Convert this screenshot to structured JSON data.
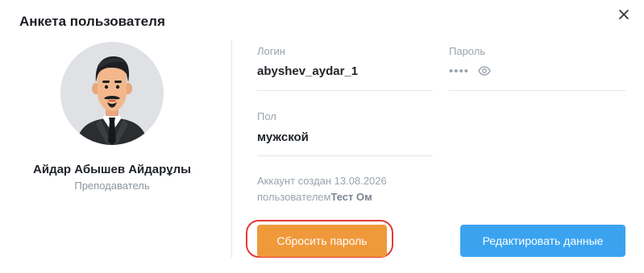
{
  "modal": {
    "title": "Анкета пользователя"
  },
  "user": {
    "name": "Айдар Абышев Айдарұлы",
    "role": "Преподаватель"
  },
  "fields": {
    "login_label": "Логин",
    "login_value": "abyshev_aydar_1",
    "password_label": "Пароль",
    "password_mask": "••••",
    "gender_label": "Пол",
    "gender_value": "мужской"
  },
  "created": {
    "prefix": "Аккаунт создан 13.08.2026",
    "by": "пользователем",
    "author": "Тест Ом"
  },
  "buttons": {
    "reset_password": "Сбросить пароль",
    "edit_data": "Редактировать данные"
  },
  "colors": {
    "reset_button": "#f0993b",
    "edit_button": "#3aa3f0",
    "highlight_ring": "#e53935",
    "avatar_background": "#dfe1e5"
  },
  "icons": {
    "close": "close-icon",
    "show_password": "eye-icon",
    "avatar": "user-avatar"
  }
}
